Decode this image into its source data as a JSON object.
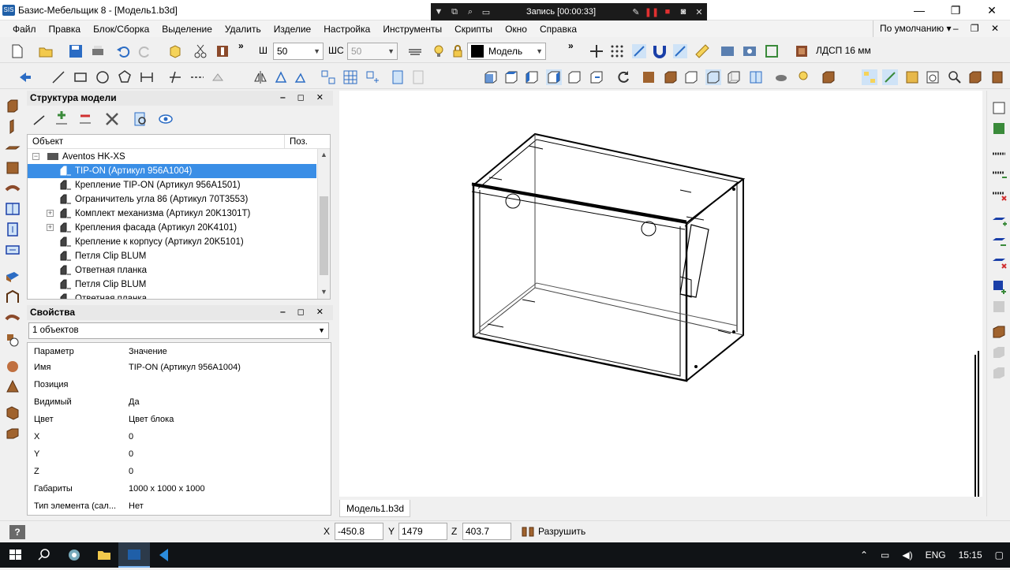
{
  "window": {
    "title": "Базис-Мебельщик 8 - [Модель1.b3d]",
    "app_icon_text": "SIS",
    "minimize": "—",
    "restore": "❐",
    "close": "✕"
  },
  "recorder": {
    "status": "Запись [00:00:33]"
  },
  "menu": {
    "items": [
      "Файл",
      "Правка",
      "Блок/Сборка",
      "Выделение",
      "Удалить",
      "Изделие",
      "Настройка",
      "Инструменты",
      "Скрипты",
      "Окно",
      "Справка"
    ],
    "profile": "По умолчанию",
    "mdi_buttons": "– ❐ ✕"
  },
  "toolbar1": {
    "width_label": "Ш",
    "width_value": "50",
    "ws_label": "ШС",
    "ws_value": "50",
    "view_mode": "Модель",
    "material": "ЛДСП 16 мм",
    "more": "»"
  },
  "structure_panel": {
    "title": "Структура модели",
    "col_object": "Объект",
    "col_pos": "Поз.",
    "root": "Aventos  HK-XS",
    "items": [
      {
        "label": "TIP-ON (Артикул 956A1004)",
        "selected": true,
        "expandable": false
      },
      {
        "label": "Крепление TIP-ON (Артикул 956A1501)",
        "selected": false,
        "expandable": false
      },
      {
        "label": "Ограничитель угла 86 (Артикул 70T3553)",
        "selected": false,
        "expandable": false
      },
      {
        "label": "Комплект механизма (Артикул 20K1301T)",
        "selected": false,
        "expandable": true
      },
      {
        "label": "Крепления фасада (Артикул 20K4101)",
        "selected": false,
        "expandable": true
      },
      {
        "label": "Крепление к корпусу (Артикул 20K5101)",
        "selected": false,
        "expandable": false
      },
      {
        "label": "Петля Clip BLUM",
        "selected": false,
        "expandable": false
      },
      {
        "label": "Ответная планка",
        "selected": false,
        "expandable": false
      },
      {
        "label": "Петля Clip BLUM",
        "selected": false,
        "expandable": false
      },
      {
        "label": "Ответная планка",
        "selected": false,
        "expandable": false
      }
    ]
  },
  "properties_panel": {
    "title": "Свойства",
    "selection": "1 объектов",
    "col_param": "Параметр",
    "col_value": "Значение",
    "rows": [
      {
        "name": "Имя",
        "value": "TIP-ON (Артикул 956A1004)"
      },
      {
        "name": "Позиция",
        "value": ""
      },
      {
        "name": "Видимый",
        "value": "Да"
      },
      {
        "name": "Цвет",
        "value": "Цвет блока"
      },
      {
        "name": "X",
        "value": "0"
      },
      {
        "name": "Y",
        "value": "0"
      },
      {
        "name": "Z",
        "value": "0"
      },
      {
        "name": "Габариты",
        "value": "1000 x 1000 x 1000"
      },
      {
        "name": "Тип элемента (сал...",
        "value": "Нет"
      }
    ]
  },
  "viewport": {
    "tab": "Модель1.b3d"
  },
  "statusbar": {
    "help": "?",
    "x_label": "X",
    "x_value": "-450.8",
    "y_label": "Y",
    "y_value": "1479",
    "z_label": "Z",
    "z_value": "403.7",
    "destroy_label": "Разрушить"
  },
  "taskbar": {
    "language": "ENG",
    "time": "15:15"
  },
  "colors": {
    "selection": "#3a8ee6",
    "accent_blue": "#1f5fa8",
    "icon_brown": "#8b4a2b"
  }
}
